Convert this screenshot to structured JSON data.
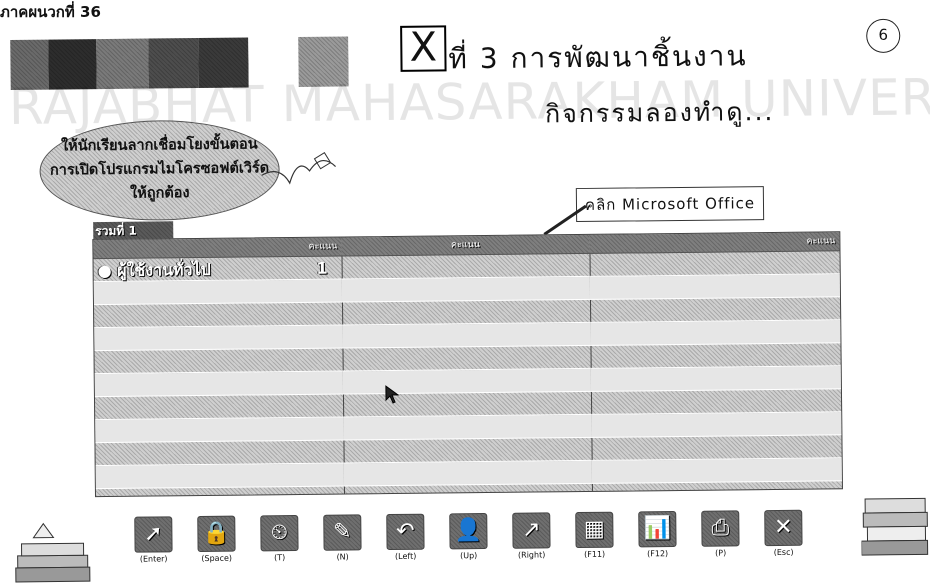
{
  "page_header": "ภาคผนวกที่ 36",
  "slide": {
    "lesson_mark": "X",
    "unit_title": "ที่ 3  การพัฒนาชิ้นงาน",
    "page_number": "6",
    "activity_title": "กิจกรรมลองทำดู...",
    "watermark": "RAJABHAT MAHASARAKHAM UNIVERS",
    "instruction_lines": [
      "ให้นักเรียนลากเชื่อมโยงขั้นตอน",
      "การเปิดโปรแกรมไมโครซอฟต์เวิร์ด",
      "ให้ถูกต้อง"
    ],
    "hint_label": "คลิก Microsoft Office",
    "panel": {
      "tab_label": "รวมที่ 1",
      "column_headers": [
        "คะแนน",
        "คะแนน",
        "คะแนน"
      ],
      "rows": [
        {
          "label": "ผู้ใช้งานทั่วไป",
          "num": "1"
        }
      ]
    },
    "toolbar": [
      {
        "name": "pointer-tool",
        "icon": "cursor-icon",
        "glyph": "➚",
        "label": "(Enter)"
      },
      {
        "name": "lock-tool",
        "icon": "lock-icon",
        "glyph": "🔒",
        "label": "(Space)"
      },
      {
        "name": "timer-tool",
        "icon": "clock-icon",
        "glyph": "⏲",
        "label": "(T)"
      },
      {
        "name": "tool-n",
        "icon": "tool-icon",
        "glyph": "✎",
        "label": "(N)"
      },
      {
        "name": "undo-tool",
        "icon": "undo-icon",
        "glyph": "↶",
        "label": "(Left)"
      },
      {
        "name": "user-tool",
        "icon": "user-icon",
        "glyph": "👤",
        "label": "(Up)"
      },
      {
        "name": "redo-tool",
        "icon": "redo-icon",
        "glyph": "↗",
        "label": "(Right)"
      },
      {
        "name": "grid-tool",
        "icon": "grid-icon",
        "glyph": "▦",
        "label": "(F11)"
      },
      {
        "name": "chart-tool",
        "icon": "bar-chart-icon",
        "glyph": "📊",
        "label": "(F12)"
      },
      {
        "name": "print-tool",
        "icon": "print-icon",
        "glyph": "⎙",
        "label": "(P)"
      },
      {
        "name": "close-tool",
        "icon": "close-icon",
        "glyph": "✕",
        "label": "(Esc)"
      }
    ],
    "colors": {
      "swatches": [
        "#6a6a6a",
        "#2d2d2d",
        "#7a7a7a",
        "#4d4d4d",
        "#3a3a3a",
        "#ffffff",
        "#9a9a9a",
        "#ffffff"
      ],
      "panel_bg": "#d4d4d4",
      "panel_header": "#8a8a8a"
    }
  }
}
